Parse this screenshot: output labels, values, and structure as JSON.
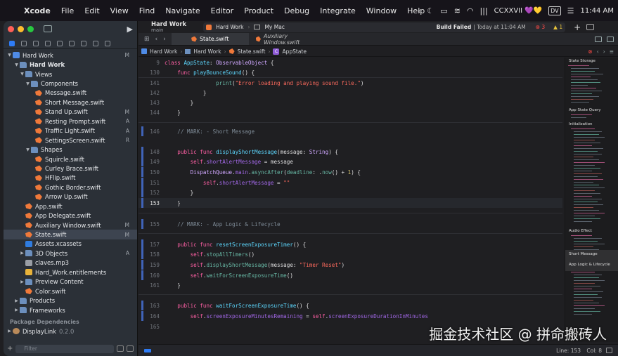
{
  "menubar": {
    "app": "Xcode",
    "items": [
      "File",
      "Edit",
      "View",
      "Find",
      "Navigate",
      "Editor",
      "Product",
      "Debug",
      "Integrate",
      "Window",
      "Help"
    ],
    "status_text": "ⅭCXXVII 💜💛",
    "keyboard": "DV",
    "clock": "11:44 AM"
  },
  "toolbar": {
    "project_name": "Hard Work",
    "branch": "main",
    "scheme": "Hard Work",
    "destination": "My Mac",
    "build_status": "Build Failed",
    "build_time": "| Today at 11:04 AM",
    "errors": "3",
    "warnings": "1"
  },
  "tabs": [
    {
      "label": "State.swift",
      "active": true
    },
    {
      "label": "Auxiliary Window.swift",
      "active": false
    }
  ],
  "jumpbar": [
    "Hard Work",
    "Hard Work",
    "State.swift",
    "AppState"
  ],
  "navigator": {
    "rows": [
      {
        "label": "Hard Work",
        "badge": "M"
      },
      {
        "label": "Hard Work",
        "badge": ""
      },
      {
        "label": "Views",
        "badge": ""
      },
      {
        "label": "Components",
        "badge": ""
      },
      {
        "label": "Message.swift",
        "badge": ""
      },
      {
        "label": "Short Message.swift",
        "badge": ""
      },
      {
        "label": "Stand Up.swift",
        "badge": "M"
      },
      {
        "label": "Resting Prompt.swift",
        "badge": "A"
      },
      {
        "label": "Traffic Light.swift",
        "badge": "A"
      },
      {
        "label": "SettingsScreen.swift",
        "badge": "R"
      },
      {
        "label": "Shapes",
        "badge": ""
      },
      {
        "label": "Squircle.swift",
        "badge": ""
      },
      {
        "label": "Curley Brace.swift",
        "badge": ""
      },
      {
        "label": "HFlip.swift",
        "badge": ""
      },
      {
        "label": "Gothic Border.swift",
        "badge": ""
      },
      {
        "label": "Arrow Up.swift",
        "badge": ""
      },
      {
        "label": "App.swift",
        "badge": ""
      },
      {
        "label": "App Delegate.swift",
        "badge": ""
      },
      {
        "label": "Auxiliary Window.swift",
        "badge": "M"
      },
      {
        "label": "State.swift",
        "badge": "M"
      },
      {
        "label": "Assets.xcassets",
        "badge": ""
      },
      {
        "label": "3D Objects",
        "badge": "A"
      },
      {
        "label": "claves.mp3",
        "badge": ""
      },
      {
        "label": "Hard_Work.entitlements",
        "badge": ""
      },
      {
        "label": "Preview Content",
        "badge": ""
      },
      {
        "label": "Color.swift",
        "badge": ""
      },
      {
        "label": "Products",
        "badge": ""
      },
      {
        "label": "Frameworks",
        "badge": ""
      }
    ],
    "section_title": "Package Dependencies",
    "packages": [
      {
        "label": "DisplayLink",
        "version": "0.2.0"
      }
    ],
    "filter_placeholder": "Filter"
  },
  "code": [
    {
      "ln": "9",
      "text": "class AppState: ObservableObject {"
    },
    {
      "ln": "130",
      "text": "    func playBounceSound() {"
    },
    {
      "ln": "141",
      "text": "                print(\"Error loading and playing sound file.\")"
    },
    {
      "ln": "142",
      "text": "            }"
    },
    {
      "ln": "143",
      "text": "        }"
    },
    {
      "ln": "144",
      "text": "    }"
    },
    {
      "ln": "146",
      "text": "    // MARK: - Short Message"
    },
    {
      "ln": "148",
      "text": "    public func displayShortMessage(message: String) {"
    },
    {
      "ln": "149",
      "text": "        self.shortAlertMessage = message"
    },
    {
      "ln": "150",
      "text": "        DispatchQueue.main.asyncAfter(deadline: .now() + 1) {"
    },
    {
      "ln": "151",
      "text": "            self.shortAlertMessage = \"\""
    },
    {
      "ln": "152",
      "text": "        }"
    },
    {
      "ln": "153",
      "text": "    }"
    },
    {
      "ln": "155",
      "text": "    // MARK: - App Logic & Lifecycle"
    },
    {
      "ln": "157",
      "text": "    public func resetScreenExposureTimer() {"
    },
    {
      "ln": "158",
      "text": "        self.stopAllTimers()"
    },
    {
      "ln": "159",
      "text": "        self.displayShortMessage(message: \"Timer Reset\")"
    },
    {
      "ln": "160",
      "text": "        self.waitForScreenExposureTime()"
    },
    {
      "ln": "161",
      "text": "    }"
    },
    {
      "ln": "163",
      "text": "    public func waitForScreenExposureTime() {"
    },
    {
      "ln": "164",
      "text": "        self.screenExposureMinutesRemaining = self.screenExposureDurationInMinutes"
    },
    {
      "ln": "165",
      "text": ""
    }
  ],
  "minimap": {
    "labels": [
      "State Storage",
      "App State Query",
      "Initialization",
      "Audio Effect",
      "Short Message",
      "App Logic & Lifecycle"
    ]
  },
  "statusbar": {
    "line": "Line: 153",
    "col": "Col: 8"
  },
  "watermark": "掘金技术社区 @ 拼命搬砖人",
  "colors": {
    "keyword": "#fc5fa3",
    "function": "#67b7a4",
    "string": "#fc6a5d",
    "comment": "#7f8c98",
    "error": "#ff4a45",
    "accent": "#2e7cf6"
  }
}
